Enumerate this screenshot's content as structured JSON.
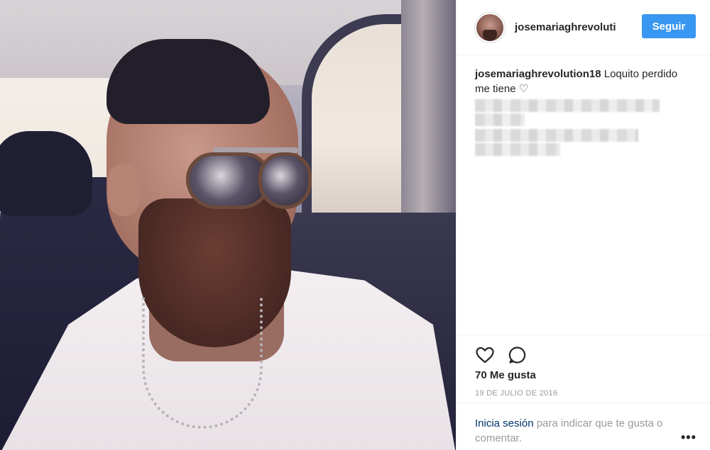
{
  "post": {
    "photo_alt": ""
  },
  "header": {
    "username": "josemariaghrevoluti",
    "follow_label": "Seguir"
  },
  "caption": {
    "username": "josemariaghrevolution18",
    "text": "Loquito perdido me tiene ♡"
  },
  "actions": {
    "like_icon": "heart-icon",
    "comment_icon": "comment-icon",
    "likes_text": "70 Me gusta",
    "date": "19 DE JULIO DE 2016"
  },
  "login": {
    "link_text": "Inicia sesión",
    "rest_text": " para indicar que te gusta o comentar.",
    "more_label": "•••"
  },
  "colors": {
    "accent": "#3897f0",
    "link": "#003569",
    "muted": "#999999"
  }
}
